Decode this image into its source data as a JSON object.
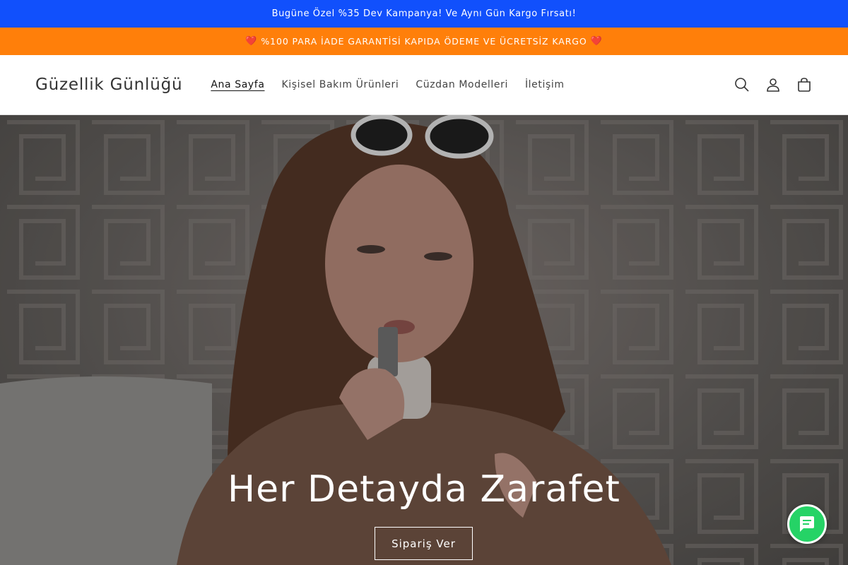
{
  "announcements": {
    "top": "Bugüne Özel %35 Dev Kampanya! Ve Aynı Gün Kargo Fırsatı!",
    "second": "%100 PARA İADE GARANTİSİ KAPIDA ÖDEME VE ÜCRETSİZ KARGO"
  },
  "header": {
    "logo": "Güzellik Günlüğü",
    "nav": [
      {
        "label": "Ana Sayfa"
      },
      {
        "label": "Kişisel Bakım Ürünleri"
      },
      {
        "label": "Cüzdan Modelleri"
      },
      {
        "label": "İletişim"
      }
    ],
    "icons": [
      "search-icon",
      "account-icon",
      "cart-icon"
    ]
  },
  "hero": {
    "title": "Her Detayda Zarafet",
    "button": "Sipariş Ver"
  },
  "colors": {
    "announcement_blue": "#1150fc",
    "announcement_orange": "#ff7f0a",
    "chat_green": "#25d366"
  }
}
